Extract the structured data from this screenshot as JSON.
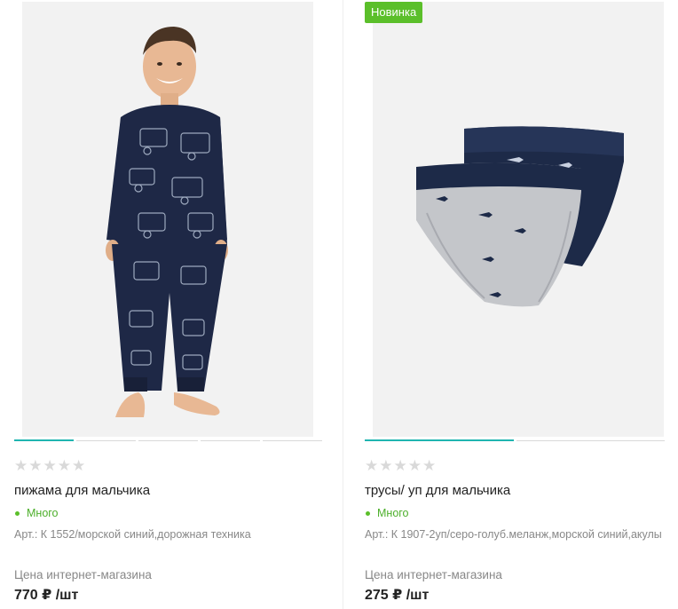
{
  "products": [
    {
      "badge": "",
      "title": "пижама для мальчика",
      "stock": "Много",
      "sku": "Арт.: К 1552/морской синий,дорожная техника",
      "price_label": "Цена интернет-магазина",
      "price": "770 ₽ /шт",
      "rating": 0,
      "slides": 5,
      "active_slide": 0
    },
    {
      "badge": "Новинка",
      "title": "трусы/ уп для мальчика",
      "stock": "Много",
      "sku": "Арт.: К 1907-2уп/серо-голуб.меланж,морской синий,акулы",
      "price_label": "Цена интернет-магазина",
      "price": "275 ₽ /шт",
      "rating": 0,
      "slides": 2,
      "active_slide": 0
    }
  ],
  "colors": {
    "accent": "#1fb5b0",
    "badge": "#5bbf2a",
    "stock": "#4caf2a"
  }
}
